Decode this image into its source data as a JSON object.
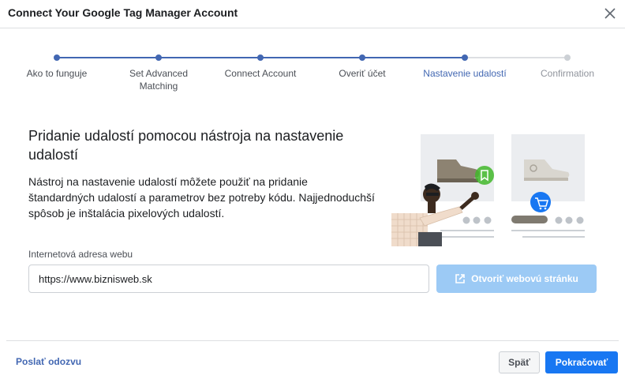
{
  "dialog": {
    "title": "Connect Your Google Tag Manager Account"
  },
  "stepper": {
    "steps": [
      {
        "label": "Ako to funguje",
        "state": "done"
      },
      {
        "label": "Set Advanced Matching",
        "state": "done"
      },
      {
        "label": "Connect Account",
        "state": "done"
      },
      {
        "label": "Overiť účet",
        "state": "done"
      },
      {
        "label": "Nastavenie udalostí",
        "state": "current"
      },
      {
        "label": "Confirmation",
        "state": "todo"
      }
    ]
  },
  "main": {
    "heading": "Pridanie udalostí pomocou nástroja na nastavenie udalostí",
    "description": "Nástroj na nastavenie udalostí môžete použiť na pridanie štandardných udalostí a parametrov bez potreby kódu. Najjednoduchší spôsob je inštalácia pixelových udalostí.",
    "url_label": "Internetová adresa webu",
    "url_value": "https://www.biznisweb.sk",
    "open_button_label": "Otvoriť webovú stránku"
  },
  "footer": {
    "feedback_label": "Poslať odozvu",
    "back_label": "Späť",
    "next_label": "Pokračovať"
  },
  "colors": {
    "accent": "#4267b2",
    "primary_button": "#1877f2",
    "disabled_button": "#9ccaf5",
    "bookmark_badge": "#42b72a",
    "cart_badge": "#1877f2"
  },
  "icons": [
    "close-icon",
    "external-link-icon",
    "bookmark-icon",
    "cart-icon"
  ]
}
